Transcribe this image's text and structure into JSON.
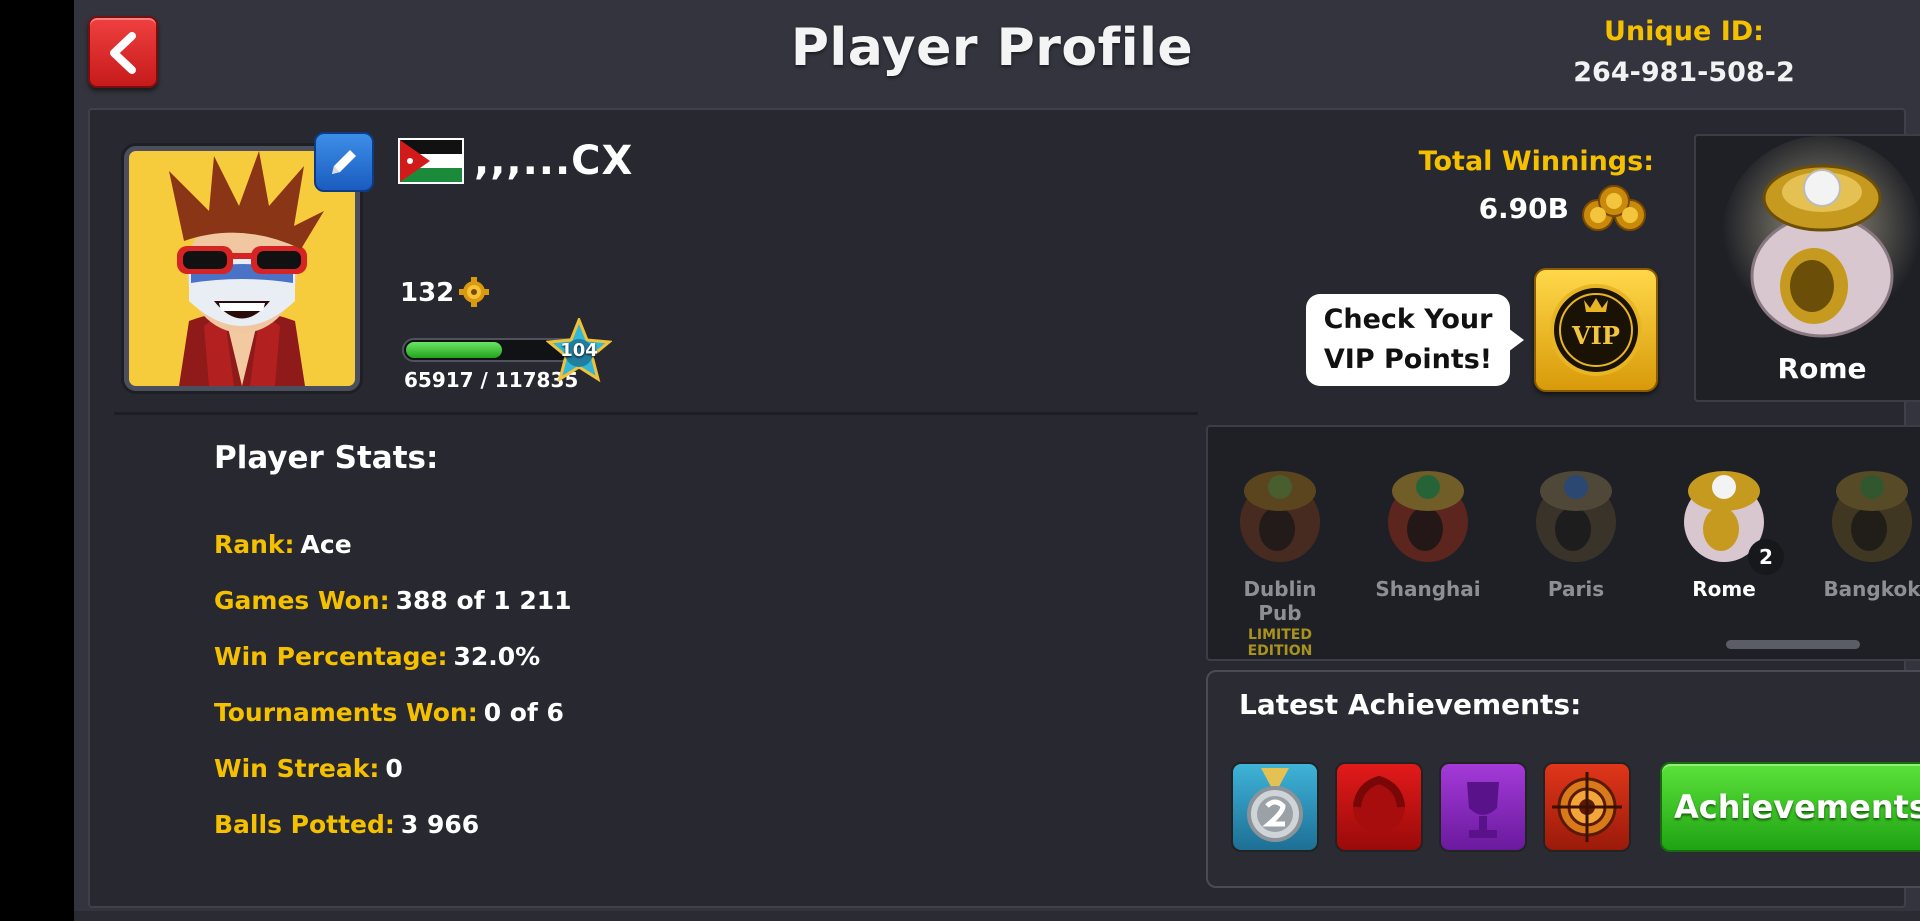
{
  "header": {
    "title": "Player Profile",
    "unique_id_label": "Unique ID:",
    "unique_id": "264-981-508-2"
  },
  "player": {
    "name": ",,,...CX",
    "flag_icon": "jordan-flag-icon",
    "coins_small": "132",
    "xp_text": "65917 / 117835",
    "xp_fraction": 0.559,
    "level": "104"
  },
  "winnings": {
    "label": "Total Winnings:",
    "value": "6.90B"
  },
  "vip": {
    "bubble_line1": "Check Your",
    "bubble_line2": "VIP Points!",
    "button_text": "VIP"
  },
  "featured_ring": {
    "label": "Rome"
  },
  "stats": {
    "heading": "Player Stats:",
    "items": [
      {
        "key": "Rank:",
        "value": "Ace"
      },
      {
        "key": "Games Won:",
        "value": "388 of 1 211"
      },
      {
        "key": "Win Percentage:",
        "value": "32.0%"
      },
      {
        "key": "Tournaments Won:",
        "value": "0 of 6"
      },
      {
        "key": "Win Streak:",
        "value": "0"
      },
      {
        "key": "Balls Potted:",
        "value": "3 966"
      }
    ]
  },
  "rings": [
    {
      "name": "Dublin Pub",
      "edition": "LIMITED EDITION"
    },
    {
      "name": "Shanghai"
    },
    {
      "name": "Paris"
    },
    {
      "name": "Rome",
      "count": "2"
    },
    {
      "name": "Bangkok"
    }
  ],
  "achievements": {
    "heading": "Latest Achievements:",
    "button_label": "Achievements",
    "badges": [
      "silver-medal-2-icon",
      "red-laurel-icon",
      "purple-trophy-icon",
      "target-icon"
    ]
  },
  "colors": {
    "accent_yellow": "#f5c000",
    "back_red": "#d42222",
    "green": "#2fb81f",
    "panel": "#282930"
  }
}
